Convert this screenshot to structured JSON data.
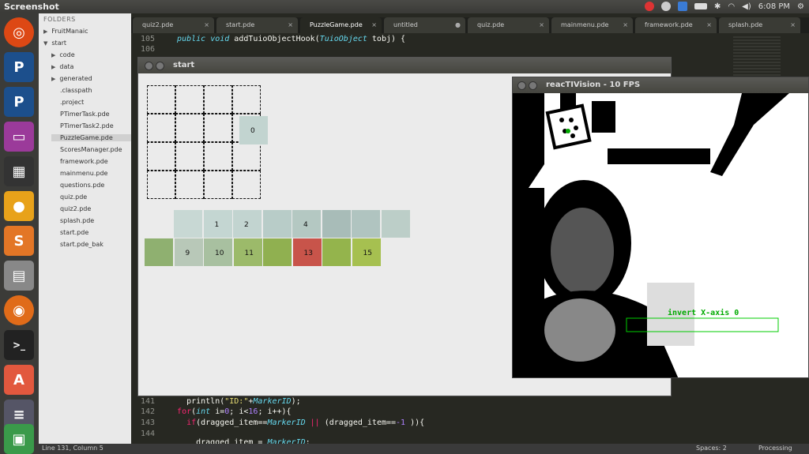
{
  "topbar": {
    "title": "Screenshot",
    "time": "6:08 PM"
  },
  "sidebar": {
    "header": "FOLDERS",
    "items": [
      {
        "label": "FruitManaic",
        "arrow": "▶",
        "indent": 1
      },
      {
        "label": "start",
        "arrow": "▼",
        "indent": 1
      },
      {
        "label": "code",
        "arrow": "▶",
        "indent": 2
      },
      {
        "label": "data",
        "arrow": "▶",
        "indent": 2
      },
      {
        "label": "generated",
        "arrow": "▶",
        "indent": 2
      },
      {
        "label": ".classpath",
        "arrow": "",
        "indent": 2
      },
      {
        "label": ".project",
        "arrow": "",
        "indent": 2
      },
      {
        "label": "PTimerTask.pde",
        "arrow": "",
        "indent": 2
      },
      {
        "label": "PTimerTask2.pde",
        "arrow": "",
        "indent": 2
      },
      {
        "label": "PuzzleGame.pde",
        "arrow": "",
        "indent": 2,
        "selected": true
      },
      {
        "label": "ScoresManager.pde",
        "arrow": "",
        "indent": 2
      },
      {
        "label": "framework.pde",
        "arrow": "",
        "indent": 2
      },
      {
        "label": "mainmenu.pde",
        "arrow": "",
        "indent": 2
      },
      {
        "label": "questions.pde",
        "arrow": "",
        "indent": 2
      },
      {
        "label": "quiz.pde",
        "arrow": "",
        "indent": 2
      },
      {
        "label": "quiz2.pde",
        "arrow": "",
        "indent": 2
      },
      {
        "label": "splash.pde",
        "arrow": "",
        "indent": 2
      },
      {
        "label": "start.pde",
        "arrow": "",
        "indent": 2
      },
      {
        "label": "start.pde_bak",
        "arrow": "",
        "indent": 2
      }
    ]
  },
  "tabs": [
    {
      "label": "quiz2.pde",
      "close": "×"
    },
    {
      "label": "start.pde",
      "close": "×"
    },
    {
      "label": "PuzzleGame.pde",
      "close": "×",
      "active": true
    },
    {
      "label": "untitled",
      "close": "●"
    },
    {
      "label": "quiz.pde",
      "close": "×"
    },
    {
      "label": "mainmenu.pde",
      "close": "×"
    },
    {
      "label": "framework.pde",
      "close": "×"
    },
    {
      "label": "splash.pde",
      "close": "×"
    }
  ],
  "code_lines": [
    {
      "num": "105",
      "html": "  <span class='ty'>public void</span> addTuioObjectHook(<span class='ty'>TuioObject</span> tobj) {"
    },
    {
      "num": "106",
      "html": ""
    },
    {
      "num": "141",
      "html": "    println(<span class='str'>\"ID:\"</span>+<span class='ty'>MarkerID</span>);"
    },
    {
      "num": "142",
      "html": "  <span class='kw'>for</span>(<span class='ty'>int</span> i=<span class='num'>0</span>; i&lt;<span class='num'>16</span>; i++){"
    },
    {
      "num": "143",
      "html": "    <span class='kw'>if</span>(dragged_item==<span class='ty'>MarkerID</span> <span class='kw'>||</span> (dragged_item==<span class='num'>-1</span> )){"
    },
    {
      "num": "144",
      "html": ""
    },
    {
      "num": "",
      "html": "      dragged_item = <span class='ty'>MarkerID</span>;"
    }
  ],
  "status": {
    "position": "Line 131, Column 5",
    "spaces": "Spaces: 2",
    "syntax": "Processing"
  },
  "start_window": {
    "title": "start",
    "placed_tile_label": "0"
  },
  "tiles": [
    {
      "label": "",
      "color": "#c8d8d4"
    },
    {
      "label": "1",
      "color": "#c4d6d2"
    },
    {
      "label": "2",
      "color": "#c2d4d0"
    },
    {
      "label": "",
      "color": "#b8ccc8"
    },
    {
      "label": "4",
      "color": "#b4c8c2"
    },
    {
      "label": "",
      "color": "#a8bcb8"
    },
    {
      "label": "",
      "color": "#b0c4c0"
    },
    {
      "label": "",
      "color": "#bccec8"
    },
    {
      "label": "",
      "color": "#8fb070"
    },
    {
      "label": "9",
      "color": "#b8c8b8"
    },
    {
      "label": "10",
      "color": "#a8c0a0"
    },
    {
      "label": "11",
      "color": "#9cba6a"
    },
    {
      "label": "",
      "color": "#90b050"
    },
    {
      "label": "13",
      "color": "#c8544a"
    },
    {
      "label": "",
      "color": "#94b44c"
    },
    {
      "label": "15",
      "color": "#a6c050"
    }
  ],
  "reactivision": {
    "title": "reacTIVision - 10 FPS",
    "overlay_text": "invert X-axis 0"
  }
}
